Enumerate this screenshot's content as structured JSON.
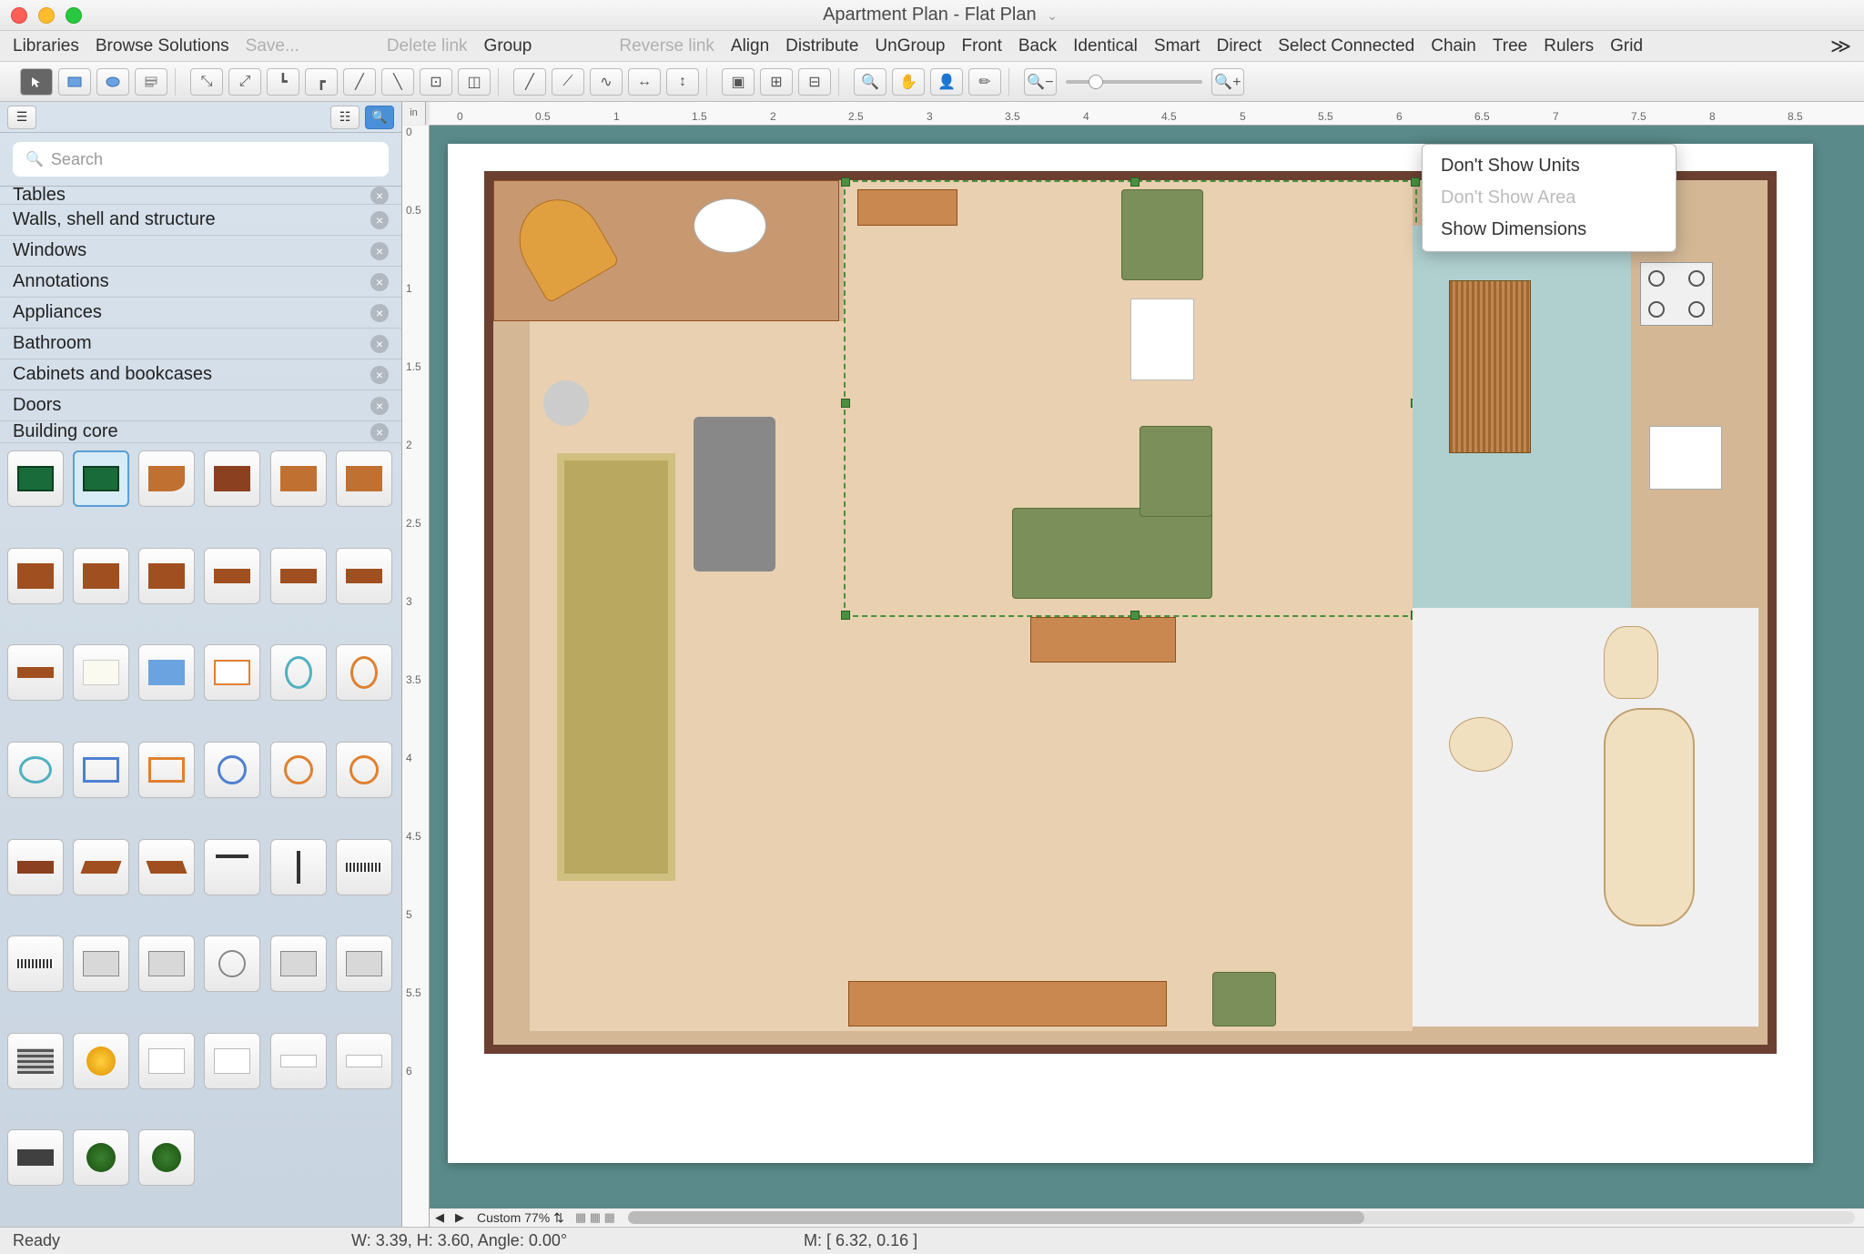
{
  "window": {
    "title": "Apartment Plan - Flat Plan"
  },
  "menubar": {
    "items": [
      "Libraries",
      "Browse Solutions",
      "Save...",
      "Delete link",
      "Group",
      "Reverse link",
      "Align",
      "Distribute",
      "UnGroup",
      "Front",
      "Back",
      "Identical",
      "Smart",
      "Direct",
      "Select Connected",
      "Chain",
      "Tree",
      "Rulers",
      "Grid"
    ],
    "disabled": [
      "Save...",
      "Delete link",
      "Reverse link"
    ]
  },
  "sidebar": {
    "search_placeholder": "Search",
    "categories": [
      "Tables",
      "Walls, shell and structure",
      "Windows",
      "Annotations",
      "Appliances",
      "Bathroom",
      "Cabinets and bookcases",
      "Doors",
      "Building core"
    ]
  },
  "ruler": {
    "unit_label": "in",
    "h_ticks": [
      "0",
      "0.5",
      "1",
      "1.5",
      "2",
      "2.5",
      "3",
      "3.5",
      "4",
      "4.5",
      "5",
      "5.5",
      "6",
      "6.5",
      "7",
      "7.5",
      "8",
      "8.5"
    ],
    "v_ticks": [
      "0",
      "0.5",
      "1",
      "1.5",
      "2",
      "2.5",
      "3",
      "3.5",
      "4",
      "4.5",
      "5",
      "5.5",
      "6"
    ]
  },
  "contextmenu": {
    "items": [
      {
        "label": "Don't Show Units",
        "disabled": false
      },
      {
        "label": "Don't Show Area",
        "disabled": true
      },
      {
        "label": "Show Dimensions",
        "disabled": false
      }
    ]
  },
  "zoom": {
    "label": "Custom 77%"
  },
  "status": {
    "ready": "Ready",
    "dims": "W: 3.39,  H: 3.60,  Angle: 0.00°",
    "mouse": "M: [ 6.32, 0.16 ]"
  }
}
